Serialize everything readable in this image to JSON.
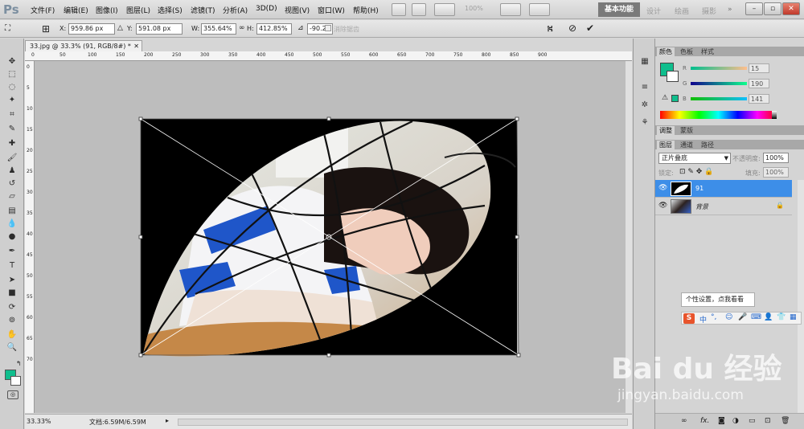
{
  "app": {
    "logo": "Ps"
  },
  "menu": [
    "文件(F)",
    "编辑(E)",
    "图像(I)",
    "图层(L)",
    "选择(S)",
    "滤镜(T)",
    "分析(A)",
    "3D(D)",
    "视图(V)",
    "窗口(W)",
    "帮助(H)"
  ],
  "zoom_field": "100%",
  "workspaces": {
    "active": "基本功能",
    "others": [
      "设计",
      "绘画",
      "摄影"
    ]
  },
  "options": {
    "x_label": "X:",
    "x_value": "959.86 px",
    "y_label": "Y:",
    "y_value": "591.08 px",
    "w_label": "W:",
    "w_value": "355.64%",
    "h_label": "H:",
    "h_value": "412.85%",
    "angle_value": "-90.27",
    "antialias_label": "消除锯齿"
  },
  "document": {
    "tab_title": "33.jpg @ 33.3% (91, RGB/8#) *",
    "ruler_h": [
      "0",
      "50",
      "100",
      "150",
      "200",
      "250",
      "300",
      "350",
      "400",
      "450",
      "500",
      "550",
      "600",
      "650",
      "700",
      "750",
      "800",
      "850",
      "900"
    ],
    "ruler_v": [
      "0",
      "5",
      "10",
      "15",
      "20",
      "25",
      "30",
      "35",
      "40",
      "45",
      "50",
      "55",
      "60",
      "65",
      "70"
    ],
    "zoom": "33.33%",
    "doc_info": "文档:6.59M/6.59M"
  },
  "color_panel": {
    "tabs": [
      "颜色",
      "色板",
      "样式"
    ],
    "r_label": "R",
    "r_value": "15",
    "g_label": "G",
    "g_value": "190",
    "b_label": "B",
    "b_value": "141",
    "foreground": "#0fbe8d"
  },
  "adjust_tabs": [
    "调整",
    "蒙版"
  ],
  "layers_panel": {
    "tabs": [
      "图层",
      "通道",
      "路径"
    ],
    "blend_mode": "正片叠底",
    "opacity_label": "不透明度:",
    "opacity": "100%",
    "lock_label": "锁定:",
    "fill_label": "填充:",
    "fill": "100%",
    "layers": [
      {
        "name": "91",
        "selected": true
      },
      {
        "name": "背景",
        "selected": false
      }
    ]
  },
  "ime": {
    "tooltip": "个性设置，点我看看",
    "lang": "中"
  },
  "watermark": {
    "brand": "Bai du 经验",
    "url": "jingyan.baidu.com"
  }
}
